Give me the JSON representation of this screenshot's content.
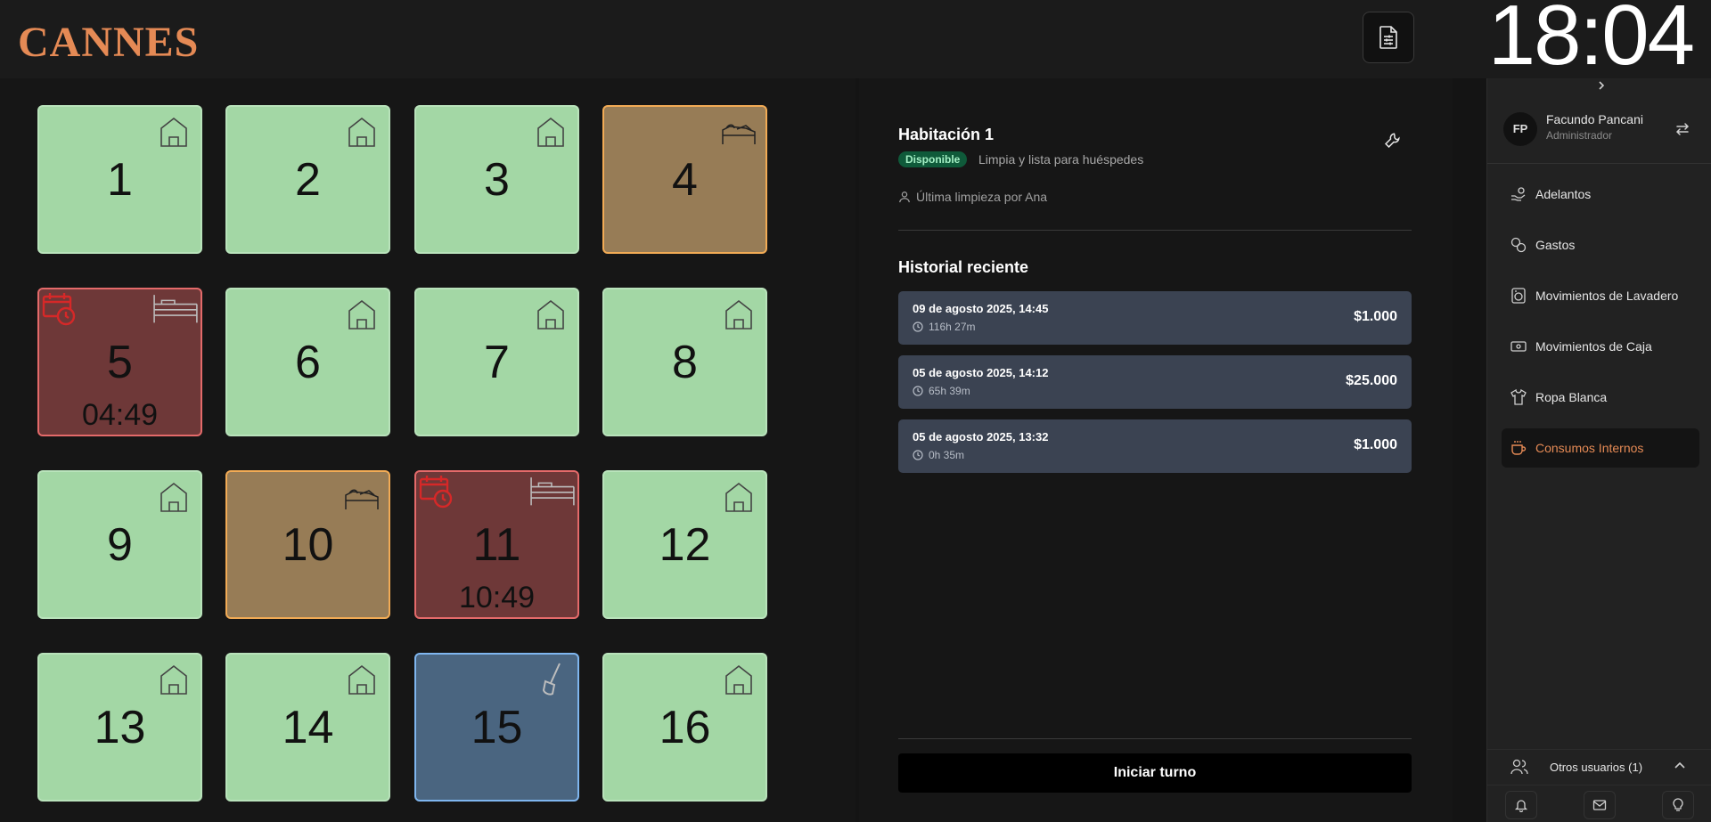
{
  "header": {
    "logo": "CANNES",
    "clock": "18:04",
    "report_icon": "report-settings-icon"
  },
  "rooms": [
    {
      "number": "1",
      "status": "available",
      "icon": "home-icon"
    },
    {
      "number": "2",
      "status": "available",
      "icon": "home-icon"
    },
    {
      "number": "3",
      "status": "available",
      "icon": "home-icon"
    },
    {
      "number": "4",
      "status": "dirty",
      "icon": "unmade-bed-icon"
    },
    {
      "number": "5",
      "status": "occupied",
      "icon": "bed-icon",
      "time": "04:49",
      "alert_icon": "calendar-clock-icon"
    },
    {
      "number": "6",
      "status": "available",
      "icon": "home-icon"
    },
    {
      "number": "7",
      "status": "available",
      "icon": "home-icon"
    },
    {
      "number": "8",
      "status": "available",
      "icon": "home-icon"
    },
    {
      "number": "9",
      "status": "available",
      "icon": "home-icon"
    },
    {
      "number": "10",
      "status": "dirty",
      "icon": "unmade-bed-icon"
    },
    {
      "number": "11",
      "status": "occupied",
      "icon": "bed-icon",
      "time": "10:49",
      "alert_icon": "calendar-clock-icon"
    },
    {
      "number": "12",
      "status": "available",
      "icon": "home-icon"
    },
    {
      "number": "13",
      "status": "available",
      "icon": "home-icon"
    },
    {
      "number": "14",
      "status": "available",
      "icon": "home-icon"
    },
    {
      "number": "15",
      "status": "cleaning",
      "icon": "mop-icon"
    },
    {
      "number": "16",
      "status": "available",
      "icon": "home-icon"
    }
  ],
  "detail": {
    "title": "Habitación 1",
    "badge": "Disponible",
    "status_desc": "Limpia y lista para huéspedes",
    "last_clean": "Última limpieza por Ana",
    "history_title": "Historial reciente",
    "history": [
      {
        "date": "09 de agosto 2025, 14:45",
        "duration": "116h 27m",
        "amount": "$1.000"
      },
      {
        "date": "05 de agosto 2025, 14:12",
        "duration": "65h 39m",
        "amount": "$25.000"
      },
      {
        "date": "05 de agosto 2025, 13:32",
        "duration": "0h 35m",
        "amount": "$1.000"
      }
    ],
    "start_button": "Iniciar turno"
  },
  "sidebar": {
    "user": {
      "initials": "FP",
      "name": "Facundo Pancani",
      "role": "Administrador"
    },
    "items": [
      {
        "label": "Adelantos",
        "icon": "hand-coins-icon",
        "active": false
      },
      {
        "label": "Gastos",
        "icon": "coins-icon",
        "active": false
      },
      {
        "label": "Movimientos de Lavadero",
        "icon": "washing-machine-icon",
        "active": false
      },
      {
        "label": "Movimientos de Caja",
        "icon": "banknote-icon",
        "active": false
      },
      {
        "label": "Ropa Blanca",
        "icon": "shirt-icon",
        "active": false
      },
      {
        "label": "Consumos Internos",
        "icon": "coffee-icon",
        "active": true
      }
    ],
    "others_label": "Otros usuarios (1)",
    "colors": {
      "accent": "#e58a55"
    }
  }
}
